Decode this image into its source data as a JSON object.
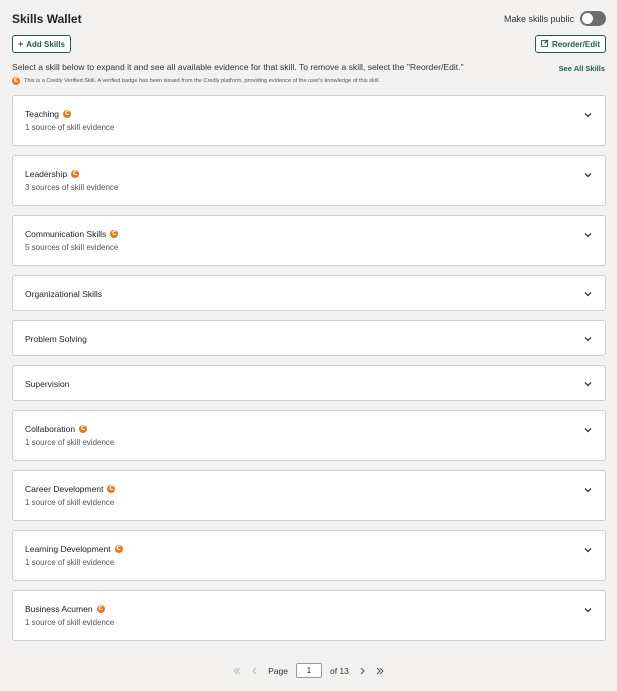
{
  "header": {
    "title": "Skills Wallet",
    "public_label": "Make skills public",
    "public_enabled": false
  },
  "toolbar": {
    "add_label": "Add Skills",
    "reorder_label": "Reorder/Edit"
  },
  "instructions": "Select a skill below to expand it and see all available evidence for that skill. To remove a skill, select the \"Reorder/Edit.\"",
  "see_all_label": "See All Skills",
  "verified_note": "This is a Credly Verified Skill. A verified badge has been issued from the Credly platform, providing evidence of the user's knowledge of this skill.",
  "credly_icon_letter": "C",
  "colors": {
    "accent": "#1d5c4b",
    "credly": "#e87722",
    "background": "#f3f2f1"
  },
  "skills": [
    {
      "name": "Teaching",
      "verified": true,
      "evidence": "1 source of skill evidence"
    },
    {
      "name": "Leadership",
      "verified": true,
      "evidence": "3 sources of skill evidence"
    },
    {
      "name": "Communication Skills",
      "verified": true,
      "evidence": "5 sources of skill evidence"
    },
    {
      "name": "Organizational Skills",
      "verified": false,
      "evidence": ""
    },
    {
      "name": "Problem Solving",
      "verified": false,
      "evidence": ""
    },
    {
      "name": "Supervision",
      "verified": false,
      "evidence": ""
    },
    {
      "name": "Collaboration",
      "verified": true,
      "evidence": "1 source of skill evidence"
    },
    {
      "name": "Career Development",
      "verified": true,
      "evidence": "1 source of skill evidence"
    },
    {
      "name": "Learning Development",
      "verified": true,
      "evidence": "1 source of skill evidence"
    },
    {
      "name": "Business Acumen",
      "verified": true,
      "evidence": "1 source of skill evidence"
    }
  ],
  "pagination": {
    "page_label": "Page",
    "current_page": "1",
    "of_label": "of 13"
  }
}
